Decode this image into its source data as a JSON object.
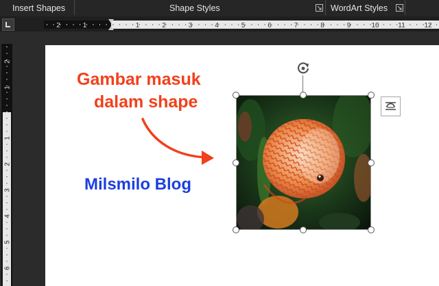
{
  "ribbon": {
    "groups": [
      {
        "label": "Insert Shapes"
      },
      {
        "label": "Shape Styles"
      },
      {
        "label": "WordArt Styles"
      }
    ]
  },
  "ruler": {
    "horizontal_labels": [
      "2",
      "1",
      "1",
      "2",
      "3",
      "4",
      "5",
      "6",
      "7",
      "8",
      "9",
      "10",
      "11",
      "12"
    ],
    "vertical_labels": [
      "2",
      "1",
      "1",
      "2",
      "3",
      "4",
      "5",
      "6"
    ]
  },
  "document": {
    "annotation_line1": "Gambar masuk",
    "annotation_line2": "dalam shape",
    "blog_text": "Milsmilo Blog"
  },
  "colors": {
    "annotation": "#f2401b",
    "blog_text": "#1c3fe0",
    "ribbon_bg": "#262626",
    "page_bg": "#ffffff"
  },
  "icons": {
    "rotate": "rotate-handle-icon",
    "layout_options": "layout-options-icon",
    "dialog_launcher": "dialog-launcher-icon"
  }
}
